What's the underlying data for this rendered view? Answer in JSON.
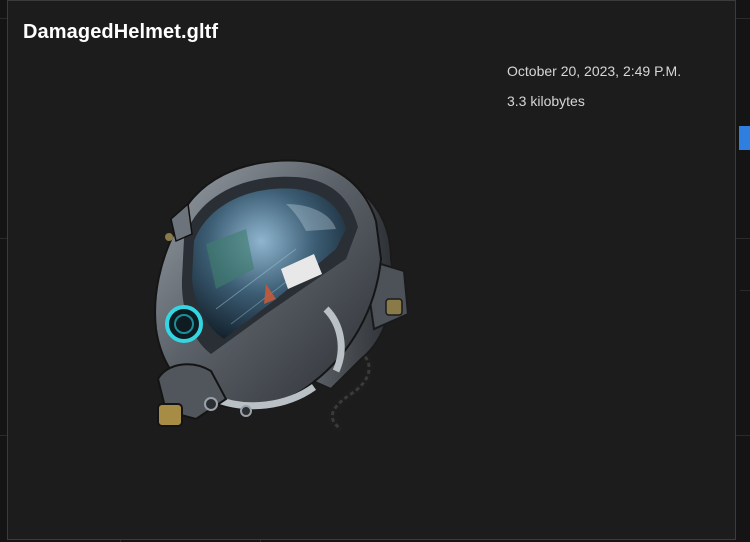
{
  "file": {
    "name": "DamagedHelmet.gltf",
    "modified": "October 20, 2023, 2:49 P.M.",
    "size": "3.3 kilobytes"
  },
  "preview": {
    "subject": "damaged-helmet-3d-model",
    "accent_color": "#2f7fe0"
  }
}
